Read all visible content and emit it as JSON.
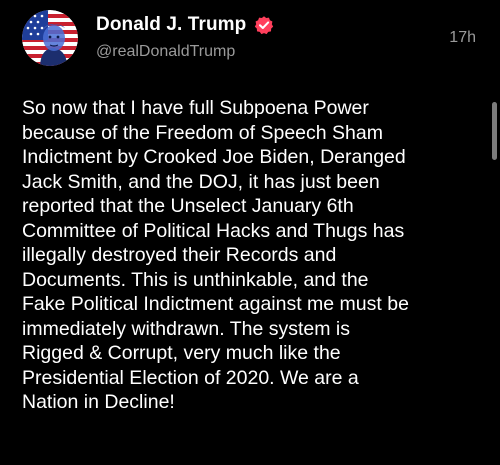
{
  "post": {
    "author": {
      "display_name": "Donald J. Trump",
      "handle": "@realDonaldTrump",
      "verified": true,
      "verified_icon": "verified-badge-icon",
      "avatar_icon": "avatar"
    },
    "timestamp": "17h",
    "body_lines": [
      "So now that I have full Subpoena Power",
      "because of the Freedom of Speech Sham",
      "Indictment by Crooked Joe Biden, Deranged",
      "Jack Smith, and the DOJ, it has just been",
      "reported that the Unselect January 6th",
      "Committee of Political Hacks and Thugs has",
      "illegally destroyed their Records and",
      "Documents. This is unthinkable, and the",
      "Fake Political Indictment against me must be",
      "immediately withdrawn. The system is",
      "Rigged & Corrupt, very much like the",
      "Presidential Election of 2020. We are a",
      "Nation in Decline!"
    ]
  },
  "colors": {
    "background": "#000000",
    "text": "#ffffff",
    "secondary_text": "#9a9a9a",
    "verified_badge": "#ff3f5c",
    "scrollbar": "#7c7c7c"
  }
}
